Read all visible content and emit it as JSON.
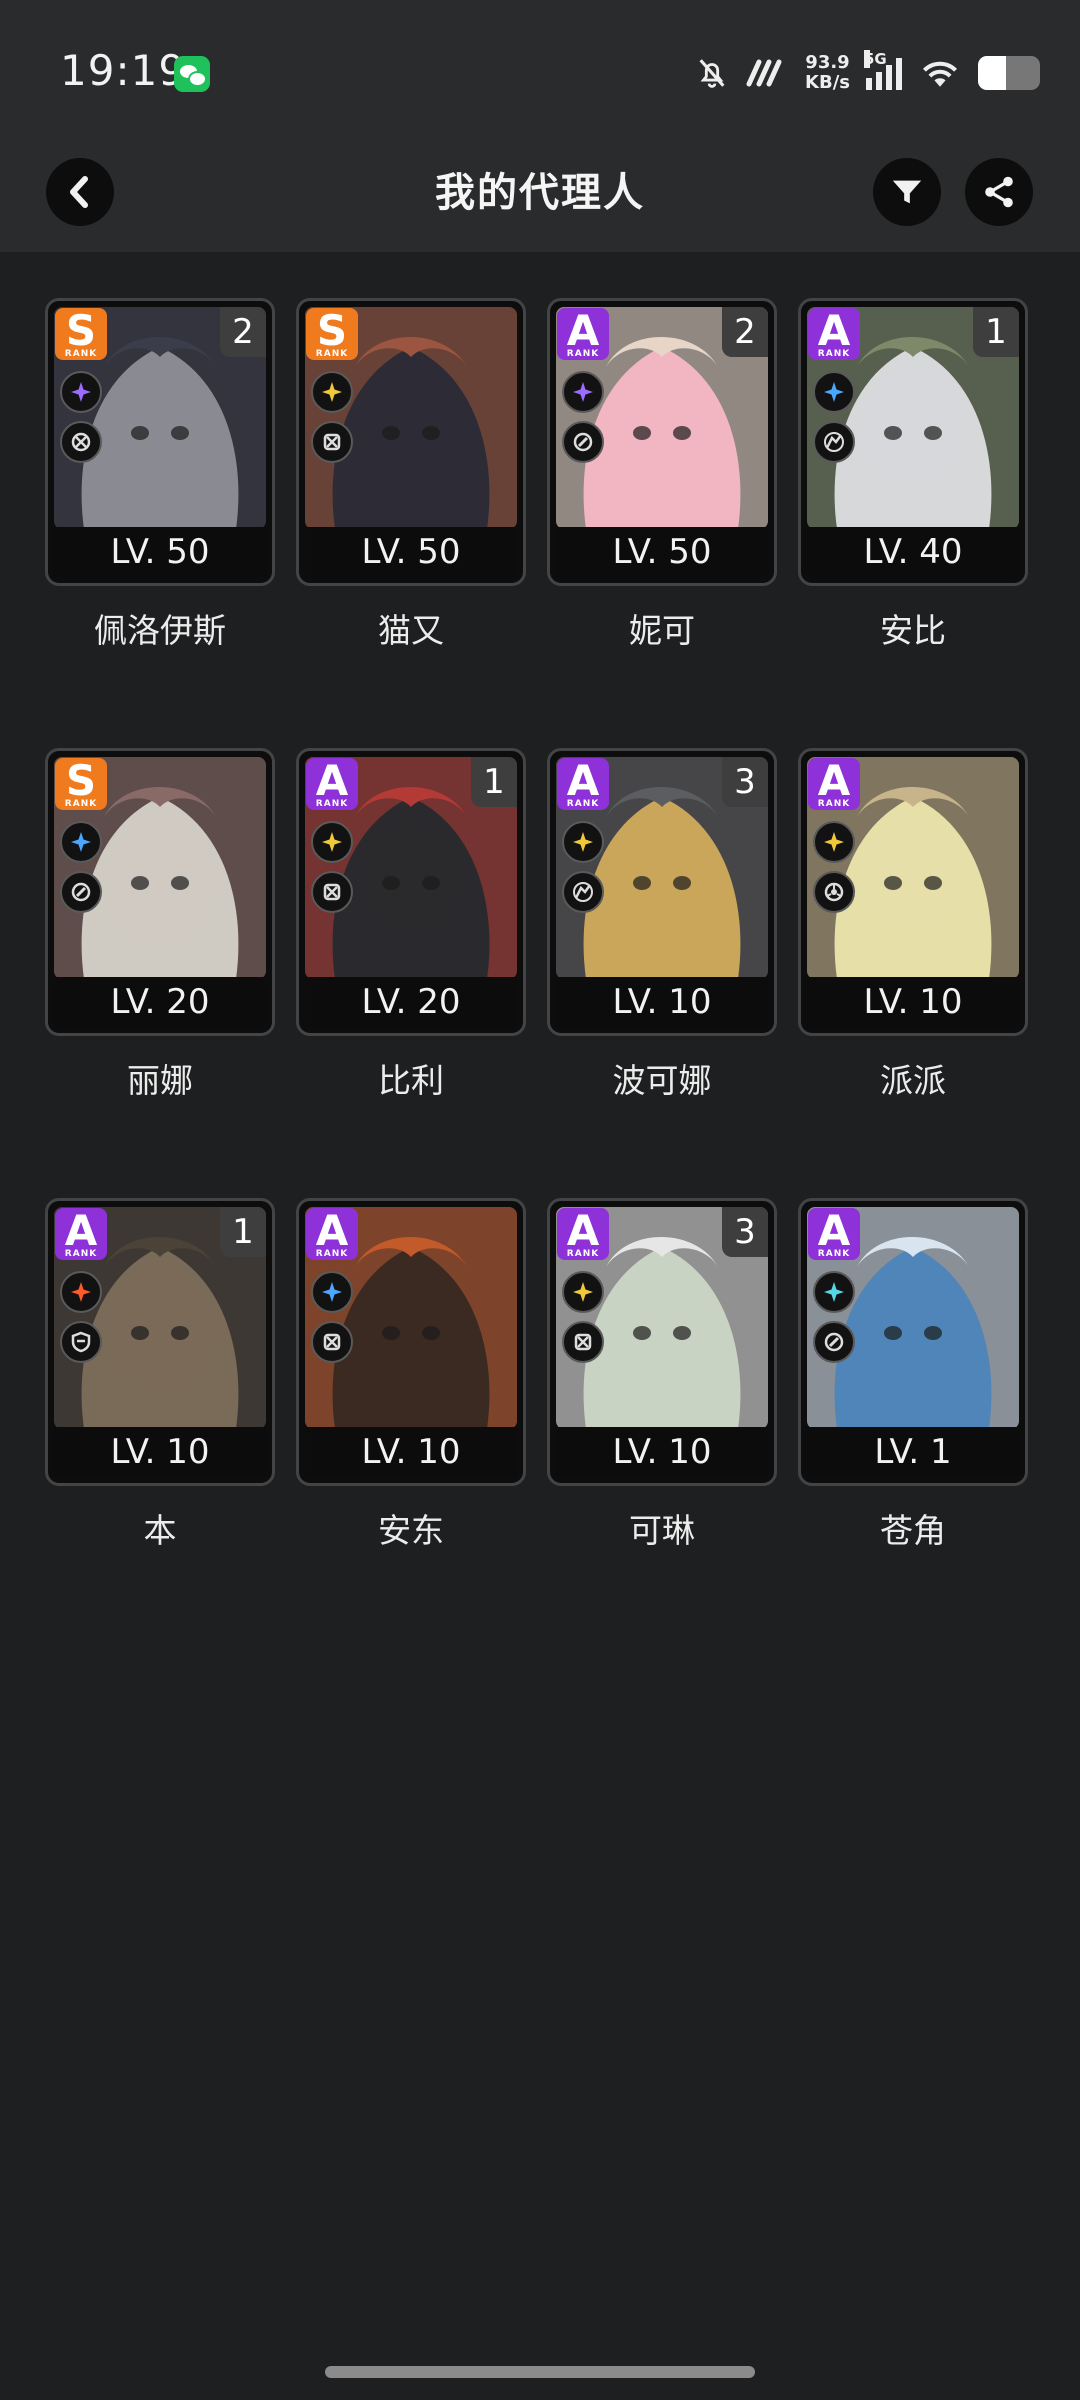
{
  "status_bar": {
    "time": "19:19",
    "network_speed": "93.9",
    "network_speed_unit": "KB/s",
    "network_type": "5G",
    "battery_level": 0.45
  },
  "header": {
    "title": "我的代理人"
  },
  "agents": [
    {
      "name": "佩洛伊斯",
      "level": "LV. 50",
      "rank": "S",
      "dupe": "2",
      "attr_color": "#9b6cff",
      "spec_icon": "strike-icon",
      "art": [
        "#8a8a92",
        "#3b3d4a"
      ]
    },
    {
      "name": "猫又",
      "level": "LV. 50",
      "rank": "S",
      "dupe": "",
      "attr_color": "#f0c93a",
      "spec_icon": "attack-icon",
      "art": [
        "#2d2c36",
        "#9c5540"
      ]
    },
    {
      "name": "妮可",
      "level": "LV. 50",
      "rank": "A",
      "dupe": "2",
      "attr_color": "#9b6cff",
      "spec_icon": "support-icon",
      "art": [
        "#f2b5c2",
        "#e7d6c8"
      ]
    },
    {
      "name": "安比",
      "level": "LV. 40",
      "rank": "A",
      "dupe": "1",
      "attr_color": "#4aa6ff",
      "spec_icon": "stun-icon",
      "art": [
        "#d7d8da",
        "#7c8a6a"
      ]
    },
    {
      "name": "丽娜",
      "level": "LV. 20",
      "rank": "S",
      "dupe": "",
      "attr_color": "#4aa6ff",
      "spec_icon": "support-icon",
      "art": [
        "#cfcac2",
        "#8a6a66"
      ]
    },
    {
      "name": "比利",
      "level": "LV. 20",
      "rank": "A",
      "dupe": "1",
      "attr_color": "#f0c93a",
      "spec_icon": "attack-icon",
      "art": [
        "#2a2a2e",
        "#b33a35"
      ]
    },
    {
      "name": "波可娜",
      "level": "LV. 10",
      "rank": "A",
      "dupe": "3",
      "attr_color": "#f0c93a",
      "spec_icon": "stun-icon",
      "art": [
        "#c9a65a",
        "#5c5d60"
      ]
    },
    {
      "name": "派派",
      "level": "LV. 10",
      "rank": "A",
      "dupe": "",
      "attr_color": "#f0c93a",
      "spec_icon": "anomaly-icon",
      "art": [
        "#e7dfa8",
        "#c7b48b"
      ]
    },
    {
      "name": "本",
      "level": "LV. 10",
      "rank": "A",
      "dupe": "1",
      "attr_color": "#ff5a2a",
      "spec_icon": "defense-icon",
      "art": [
        "#7a6a58",
        "#4c4338"
      ]
    },
    {
      "name": "安东",
      "level": "LV. 10",
      "rank": "A",
      "dupe": "",
      "attr_color": "#4aa6ff",
      "spec_icon": "attack-icon",
      "art": [
        "#3b2a22",
        "#c35a2a"
      ]
    },
    {
      "name": "可琳",
      "level": "LV. 10",
      "rank": "A",
      "dupe": "3",
      "attr_color": "#f0c93a",
      "spec_icon": "attack-icon",
      "art": [
        "#c9d3c3",
        "#e6e6e6"
      ]
    },
    {
      "name": "苍角",
      "level": "LV. 1",
      "rank": "A",
      "dupe": "",
      "attr_color": "#56d6e6",
      "spec_icon": "support-icon",
      "art": [
        "#4f85b8",
        "#d8e4ef"
      ]
    }
  ]
}
